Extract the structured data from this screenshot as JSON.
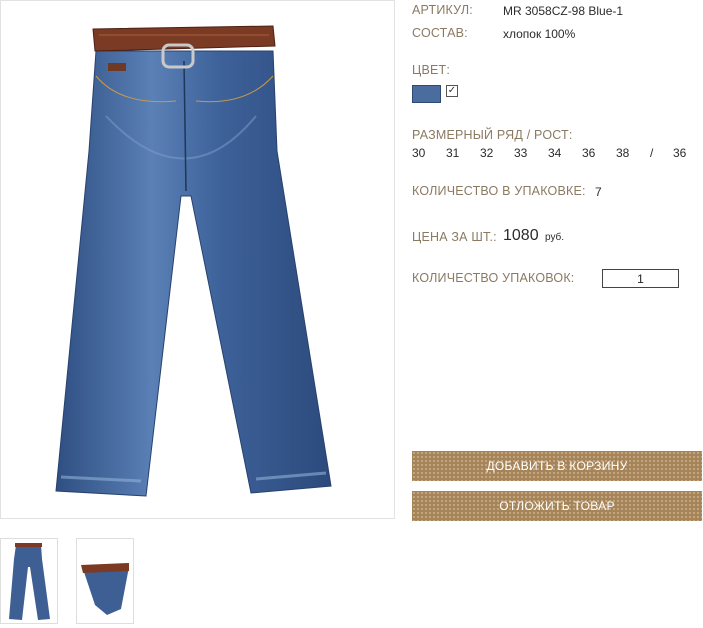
{
  "product": {
    "article_label": "АРТИКУЛ:",
    "article_value": "MR 3058CZ-98 Blue-1",
    "composition_label": "СОСТАВ:",
    "composition_value": "хлопок 100%",
    "color_label": "ЦВЕТ:",
    "color_swatch": "#4a6c9e",
    "color_checked": "✓",
    "sizes_label": "РАЗМЕРНЫЙ РЯД / РОСТ:",
    "sizes": [
      "30",
      "31",
      "32",
      "33",
      "34",
      "36",
      "38",
      "/",
      "36"
    ],
    "pack_qty_label": "КОЛИЧЕСТВО В УПАКОВКЕ:",
    "pack_qty_value": "7",
    "price_label": "ЦЕНА ЗА ШТ.:",
    "price_value": "1080",
    "price_currency": "руб.",
    "packs_label": "КОЛИЧЕСТВО УПАКОВОК:",
    "packs_value": "1"
  },
  "actions": {
    "add_to_cart": "ДОБАВИТЬ В КОРЗИНУ",
    "postpone": "ОТЛОЖИТЬ ТОВАР"
  },
  "colors": {
    "label": "#8b7a62",
    "button": "#a5845a",
    "denim": "#3d5f93",
    "belt": "#7a3a24"
  }
}
